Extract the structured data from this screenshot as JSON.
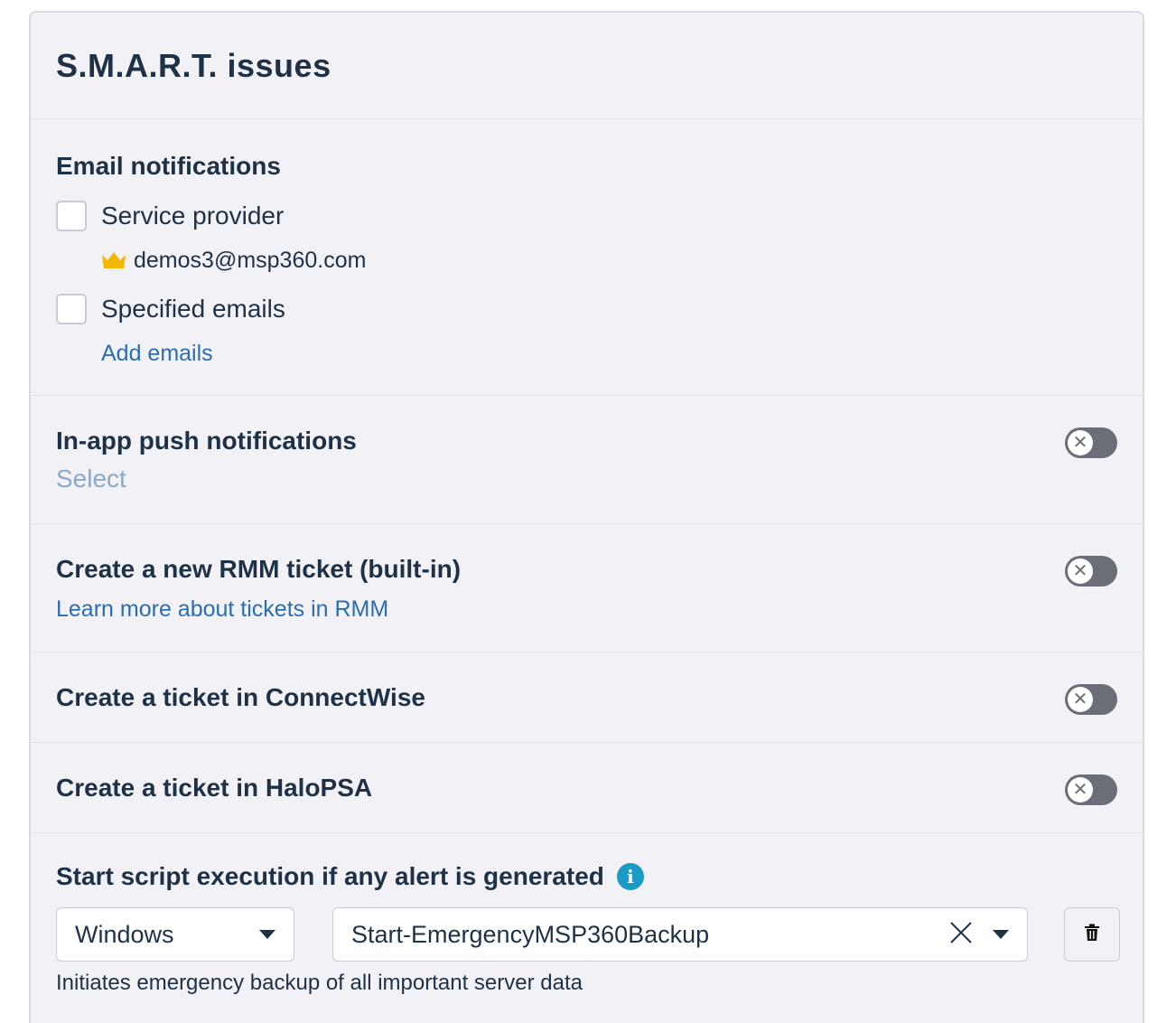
{
  "panel": {
    "title": "S.M.A.R.T. issues"
  },
  "email_notifications": {
    "heading": "Email notifications",
    "service_provider": {
      "label": "Service provider",
      "checked": false,
      "email": "demos3@msp360.com",
      "email_icon": "crown-icon"
    },
    "specified_emails": {
      "label": "Specified emails",
      "checked": false
    },
    "add_emails_link": "Add emails"
  },
  "push_notifications": {
    "heading": "In-app push notifications",
    "select_label": "Select",
    "enabled": false
  },
  "rmm_ticket": {
    "heading": "Create a new RMM ticket (built-in)",
    "learn_more_link": "Learn more about tickets in RMM",
    "enabled": false
  },
  "connectwise": {
    "heading": "Create a ticket in ConnectWise",
    "enabled": false
  },
  "halopsa": {
    "heading": "Create a ticket in HaloPSA",
    "enabled": false
  },
  "script": {
    "heading": "Start script execution if any alert is generated",
    "os_value": "Windows",
    "script_value": "Start-EmergencyMSP360Backup",
    "description": "Initiates emergency backup of all important server data"
  },
  "colors": {
    "accent_link": "#2a6db5",
    "toggle_off": "#6b6e76",
    "info": "#1b9ac6",
    "crown": "#f5b800"
  }
}
